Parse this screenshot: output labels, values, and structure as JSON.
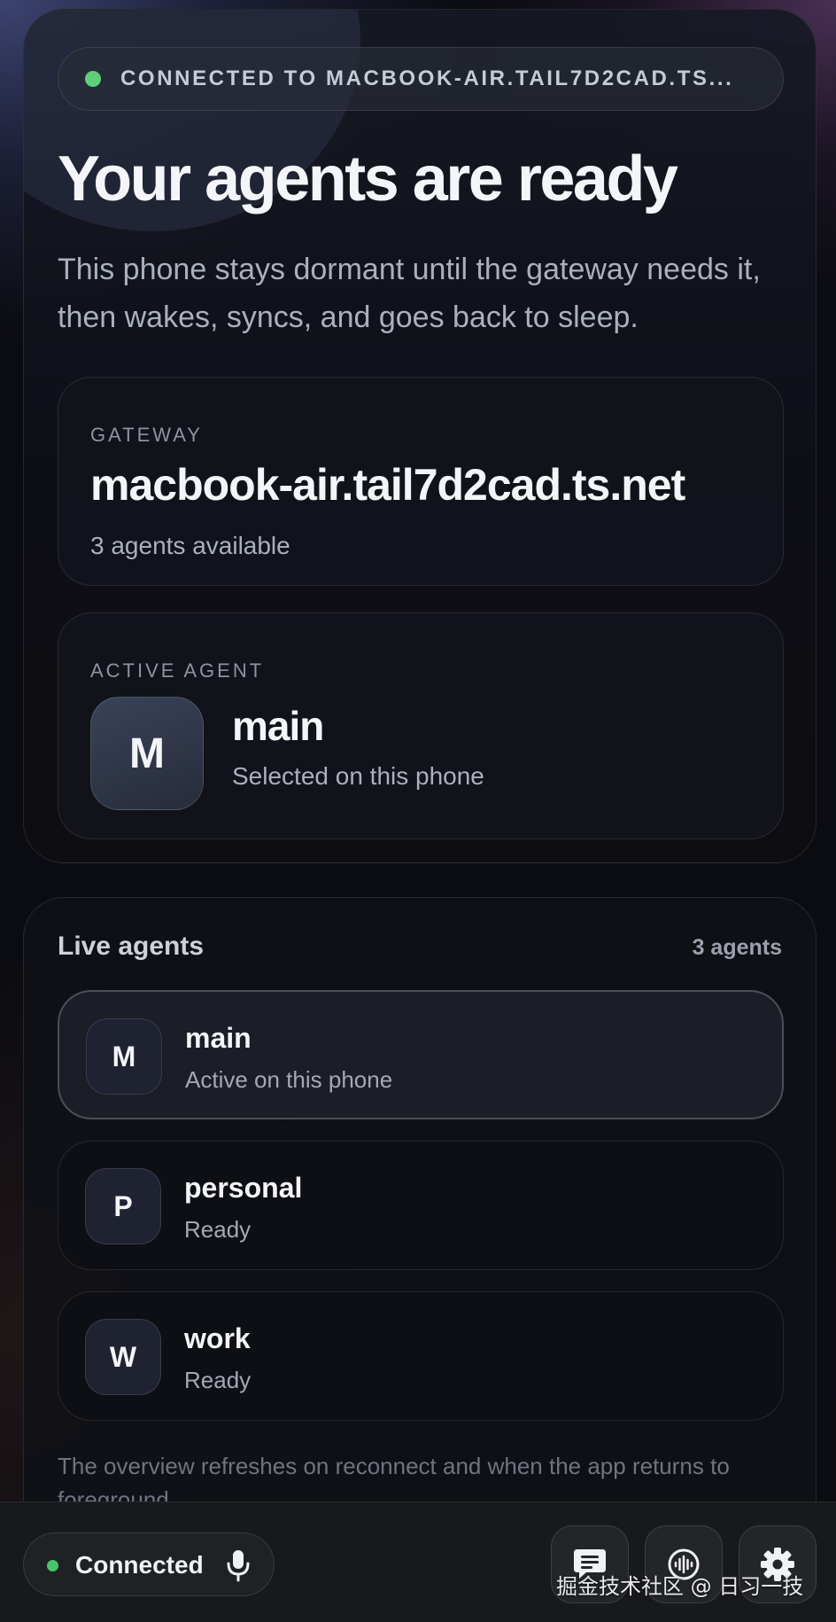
{
  "hero": {
    "connection_status": "CONNECTED TO MACBOOK-AIR.TAIL7D2CAD.TS...",
    "title": "Your agents are ready",
    "subtitle": "This phone stays dormant until the gateway needs it, then wakes, syncs, and goes back to sleep."
  },
  "gateway": {
    "label": "GATEWAY",
    "host": "macbook-air.tail7d2cad.ts.net",
    "agents_available": "3 agents available"
  },
  "active_agent": {
    "label": "ACTIVE AGENT",
    "initial": "M",
    "name": "main",
    "subtitle": "Selected on this phone"
  },
  "live_agents": {
    "title": "Live agents",
    "count": "3 agents",
    "items": [
      {
        "initial": "M",
        "name": "main",
        "status": "Active on this phone",
        "selected": true
      },
      {
        "initial": "P",
        "name": "personal",
        "status": "Ready",
        "selected": false
      },
      {
        "initial": "W",
        "name": "work",
        "status": "Ready",
        "selected": false
      }
    ],
    "footnote": "The overview refreshes on reconnect and when the app returns to foreground."
  },
  "bottom_bar": {
    "connection_label": "Connected",
    "icons": [
      "microphone-icon",
      "chat-icon",
      "voice-waveform-icon",
      "gear-icon"
    ]
  },
  "watermark": "掘金技术社区 @ 日习一技",
  "colors": {
    "status_green": "#5fcf7b",
    "background": "#0b0c11",
    "card_border": "rgba(255,255,255,0.10)"
  }
}
